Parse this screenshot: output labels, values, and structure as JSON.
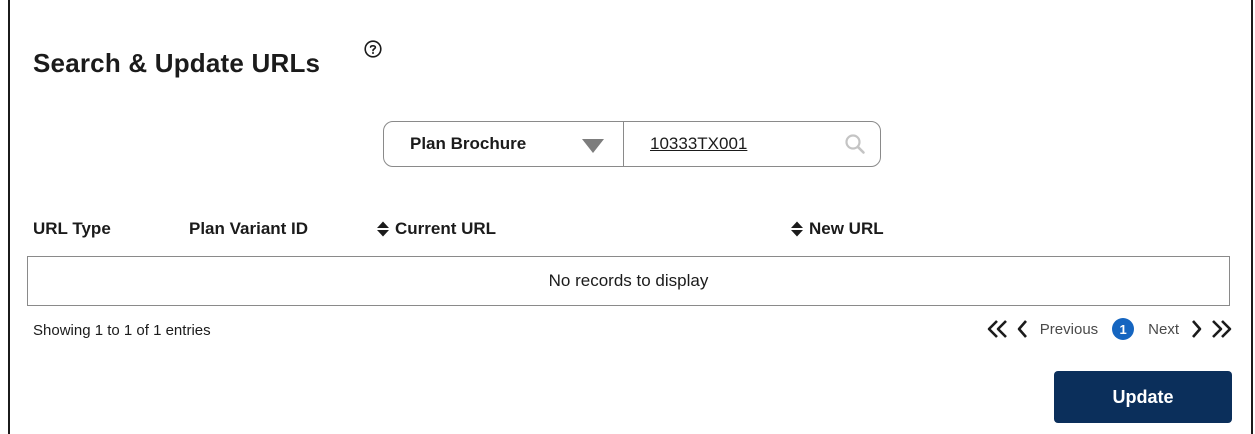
{
  "page": {
    "title": "Search & Update URLs"
  },
  "search": {
    "type_selected": "Plan Brochure",
    "value": "10333TX001"
  },
  "table": {
    "columns": [
      "URL Type",
      "Plan Variant ID",
      "Current URL",
      "New URL"
    ],
    "empty_message": "No records to display"
  },
  "footer": {
    "showing_text": "Showing 1 to 1 of 1 entries",
    "previous_label": "Previous",
    "current_page": "1",
    "next_label": "Next"
  },
  "actions": {
    "update_label": "Update"
  },
  "icons": {
    "help": "help-circle-icon",
    "caret": "caret-down-icon",
    "search": "search-icon",
    "sort": "sort-icon",
    "first": "double-chevron-left-icon",
    "prev": "chevron-left-icon",
    "next": "chevron-right-icon",
    "last": "double-chevron-right-icon"
  },
  "colors": {
    "primary_button": "#0b2f5b",
    "page_badge": "#1565c0",
    "border": "#8a8a8a"
  }
}
